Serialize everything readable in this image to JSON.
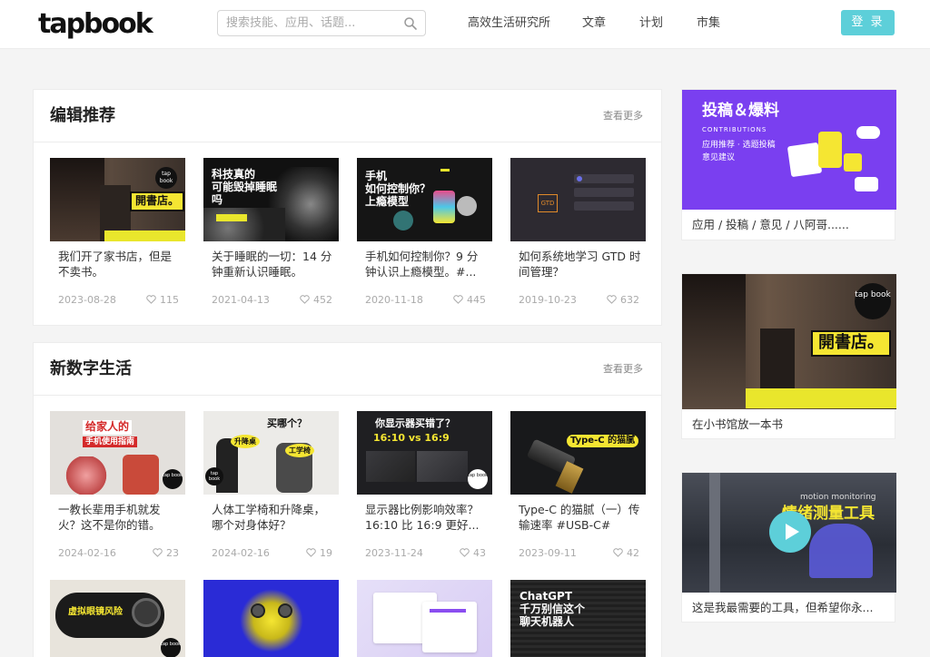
{
  "header": {
    "logo": "tapbook",
    "search_placeholder": "搜索技能、应用、话题...",
    "nav": [
      "高效生活研究所",
      "文章",
      "计划",
      "市集"
    ],
    "login": "登 录"
  },
  "sections": [
    {
      "title": "编辑推荐",
      "more": "查看更多",
      "cards": [
        {
          "title": "我们开了家书店，但是不卖书。",
          "date": "2023-08-28",
          "likes": "115",
          "overlay": [
            "開書店。"
          ],
          "logo_badge": "tap book"
        },
        {
          "title": "关于睡眠的一切：14 分钟重新认识睡眠。",
          "date": "2021-04-13",
          "likes": "452",
          "overlay": [
            "科技真的",
            "可能毁掉睡眠",
            "吗"
          ]
        },
        {
          "title": "手机如何控制你？9 分钟认识上瘾模型。#...",
          "date": "2020-11-18",
          "likes": "445",
          "overlay": [
            "手机",
            "如何控制你？",
            "上瘾模型"
          ]
        },
        {
          "title": "如何系统地学习 GTD 时间管理？",
          "date": "2019-10-23",
          "likes": "632",
          "overlay": [
            "GTD"
          ]
        }
      ]
    },
    {
      "title": "新数字生活",
      "more": "查看更多",
      "cards": [
        {
          "title": "一教长辈用手机就发火？这不是你的错。",
          "date": "2024-02-16",
          "likes": "23",
          "overlay": [
            "给家人的",
            "手机使用指南"
          ],
          "logo_badge": "tap book"
        },
        {
          "title": "人体工学椅和升降桌，哪个对身体好？",
          "date": "2024-02-16",
          "likes": "19",
          "overlay": [
            "买哪个？",
            "升降桌",
            "工学椅"
          ],
          "logo_badge": "tap book"
        },
        {
          "title": "显示器比例影响效率？16:10 比 16:9 更好...",
          "date": "2023-11-24",
          "likes": "43",
          "overlay": [
            "你显示器买错了？",
            "16:10 vs 16:9"
          ],
          "logo_badge": "tap book"
        },
        {
          "title": "Type-C 的猫腻（一）传输速率 #USB-C#",
          "date": "2023-09-11",
          "likes": "42",
          "overlay": [
            "Type-C 的猫腻"
          ]
        }
      ]
    },
    {
      "cards": [
        {
          "overlay": [
            "虚拟眼镜风险"
          ],
          "logo_badge": "tap book"
        },
        {
          "overlay": []
        },
        {
          "overlay": []
        },
        {
          "overlay": [
            "ChatGPT",
            "千万别信这个",
            "聊天机器人"
          ]
        }
      ]
    }
  ],
  "sidebar": [
    {
      "text": "应用 / 投稿 / 意见 / 八阿哥......",
      "overlay": [
        "投稿＆爆料",
        "CONTRIBUTIONS",
        "应用推荐 · 选题投稿",
        "意见建议"
      ]
    },
    {
      "text": "在小书馆放一本书",
      "overlay": [
        "開書店。"
      ],
      "logo_badge": "tap book"
    },
    {
      "text": "这是我最需要的工具，但希望你永...",
      "overlay": [
        "motion monitoring",
        "情绪测量工具"
      ]
    }
  ],
  "colors": {
    "accent": "#5dcfd9",
    "yellow": "#f5e632",
    "purple": "#8a4df0"
  }
}
